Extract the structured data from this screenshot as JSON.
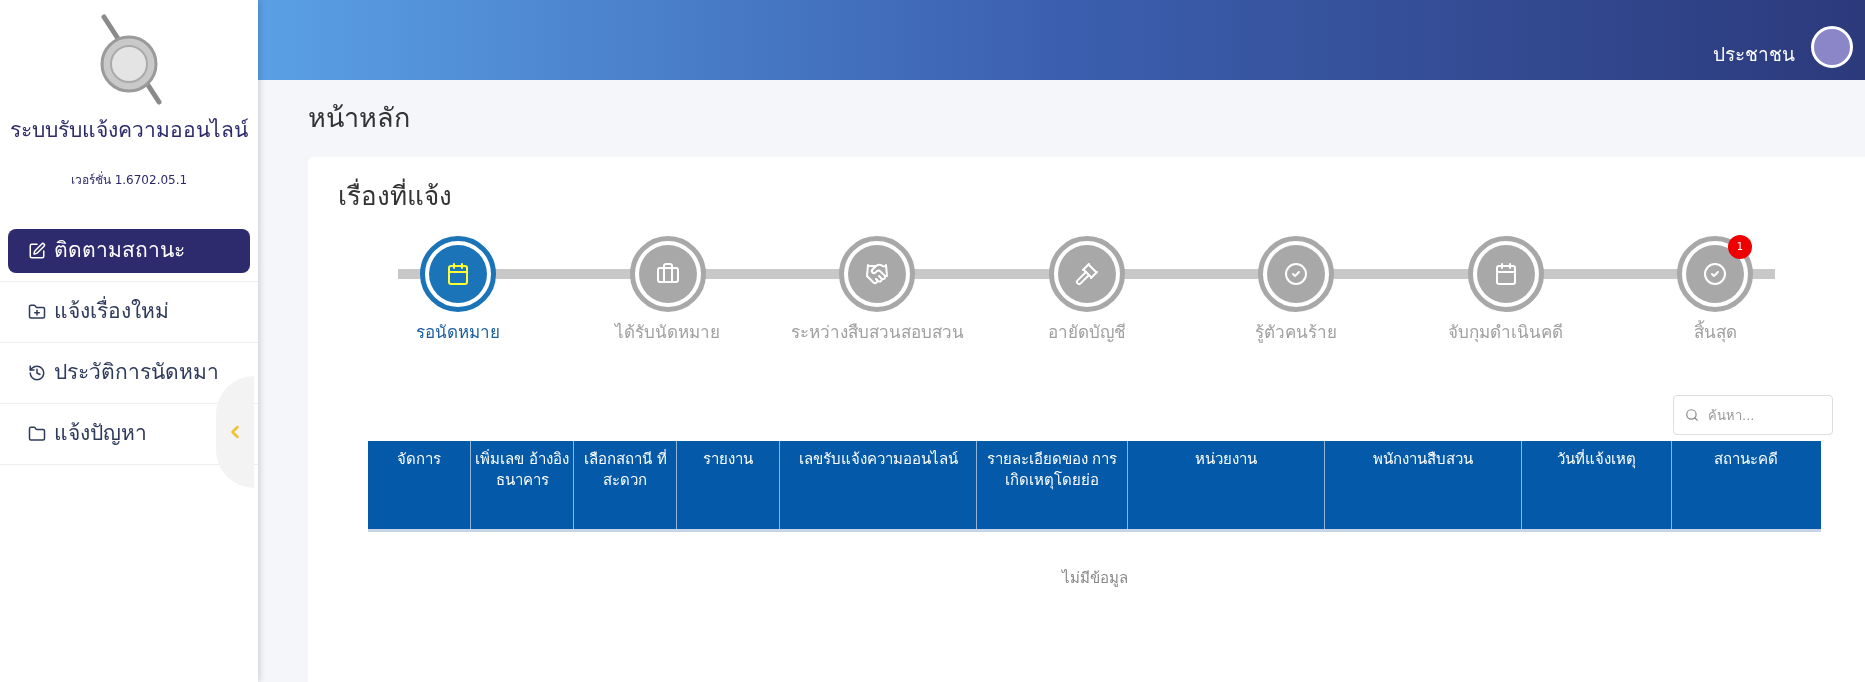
{
  "sidebar": {
    "app_title": "ระบบรับแจ้งความออนไลน์",
    "version": "เวอร์ชั่น 1.6702.05.1",
    "items": [
      {
        "label": "ติดตามสถานะ",
        "selected": true,
        "kind": "edit"
      },
      {
        "label": "แจ้งเรื่องใหม่",
        "selected": false,
        "kind": "folder-plus"
      },
      {
        "label": "ประวัติการนัดหมา",
        "selected": false,
        "kind": "history"
      },
      {
        "label": "แจ้งปัญหา",
        "selected": false,
        "kind": "folder"
      }
    ]
  },
  "header": {
    "user_name": "ประชาชน"
  },
  "page_title": "หน้าหลัก",
  "card": {
    "title": "เรื่องที่แจ้ง",
    "steps": [
      {
        "label": "รอนัดหมาย",
        "selected": true,
        "kind": "calendar"
      },
      {
        "label": "ได้รับนัดหมาย",
        "selected": false,
        "kind": "briefcase"
      },
      {
        "label": "ระหว่างสืบสวนสอบสวน",
        "selected": false,
        "kind": "handshake"
      },
      {
        "label": "อายัดบัญชี",
        "selected": false,
        "kind": "gavel"
      },
      {
        "label": "รู้ตัวคนร้าย",
        "selected": false,
        "kind": "check"
      },
      {
        "label": "จับกุมดำเนินคดี",
        "selected": false,
        "kind": "calendar"
      },
      {
        "label": "สิ้นสุด",
        "selected": false,
        "kind": "check",
        "badge": "1"
      }
    ],
    "search": {
      "placeholder": "ค้นหา..."
    },
    "table": {
      "columns": [
        "จัดการ",
        "เพิ่มเลข อ้างอิง ธนาคาร",
        "เลือกสถานี ที่สะดวก",
        "รายงาน",
        "เลขรับแจ้งความออนไลน์",
        "รายละเอียดของ การเกิดเหตุโดยย่อ",
        "หน่วยงาน",
        "พนักงานสืบสวน",
        "วันที่แจ้งเหตุ",
        "สถานะคดี"
      ],
      "empty_message": "ไม่มีข้อมูล"
    }
  }
}
